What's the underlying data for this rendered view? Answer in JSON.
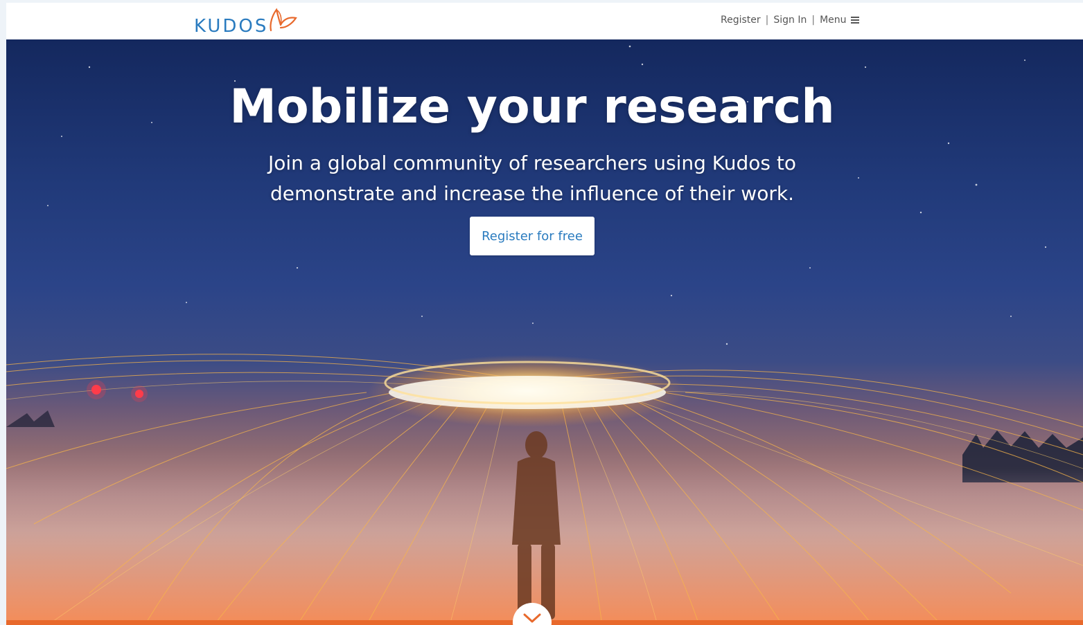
{
  "header": {
    "logo_text": "KUDOS",
    "nav": {
      "register": "Register",
      "sign_in": "Sign In",
      "menu": "Menu",
      "separator": "|"
    }
  },
  "hero": {
    "title": "Mobilize your research",
    "subtitle_line1": "Join a global community of researchers using Kudos to",
    "subtitle_line2": "demonstrate and increase the influence of their work.",
    "cta_label": "Register for free"
  },
  "colors": {
    "brand_blue": "#2a7bbf",
    "brand_orange": "#e8692c",
    "sky_dark": "#14285e"
  },
  "icons": {
    "logo": "butterfly-icon",
    "menu": "hamburger-icon",
    "scroll": "chevron-down-icon"
  }
}
